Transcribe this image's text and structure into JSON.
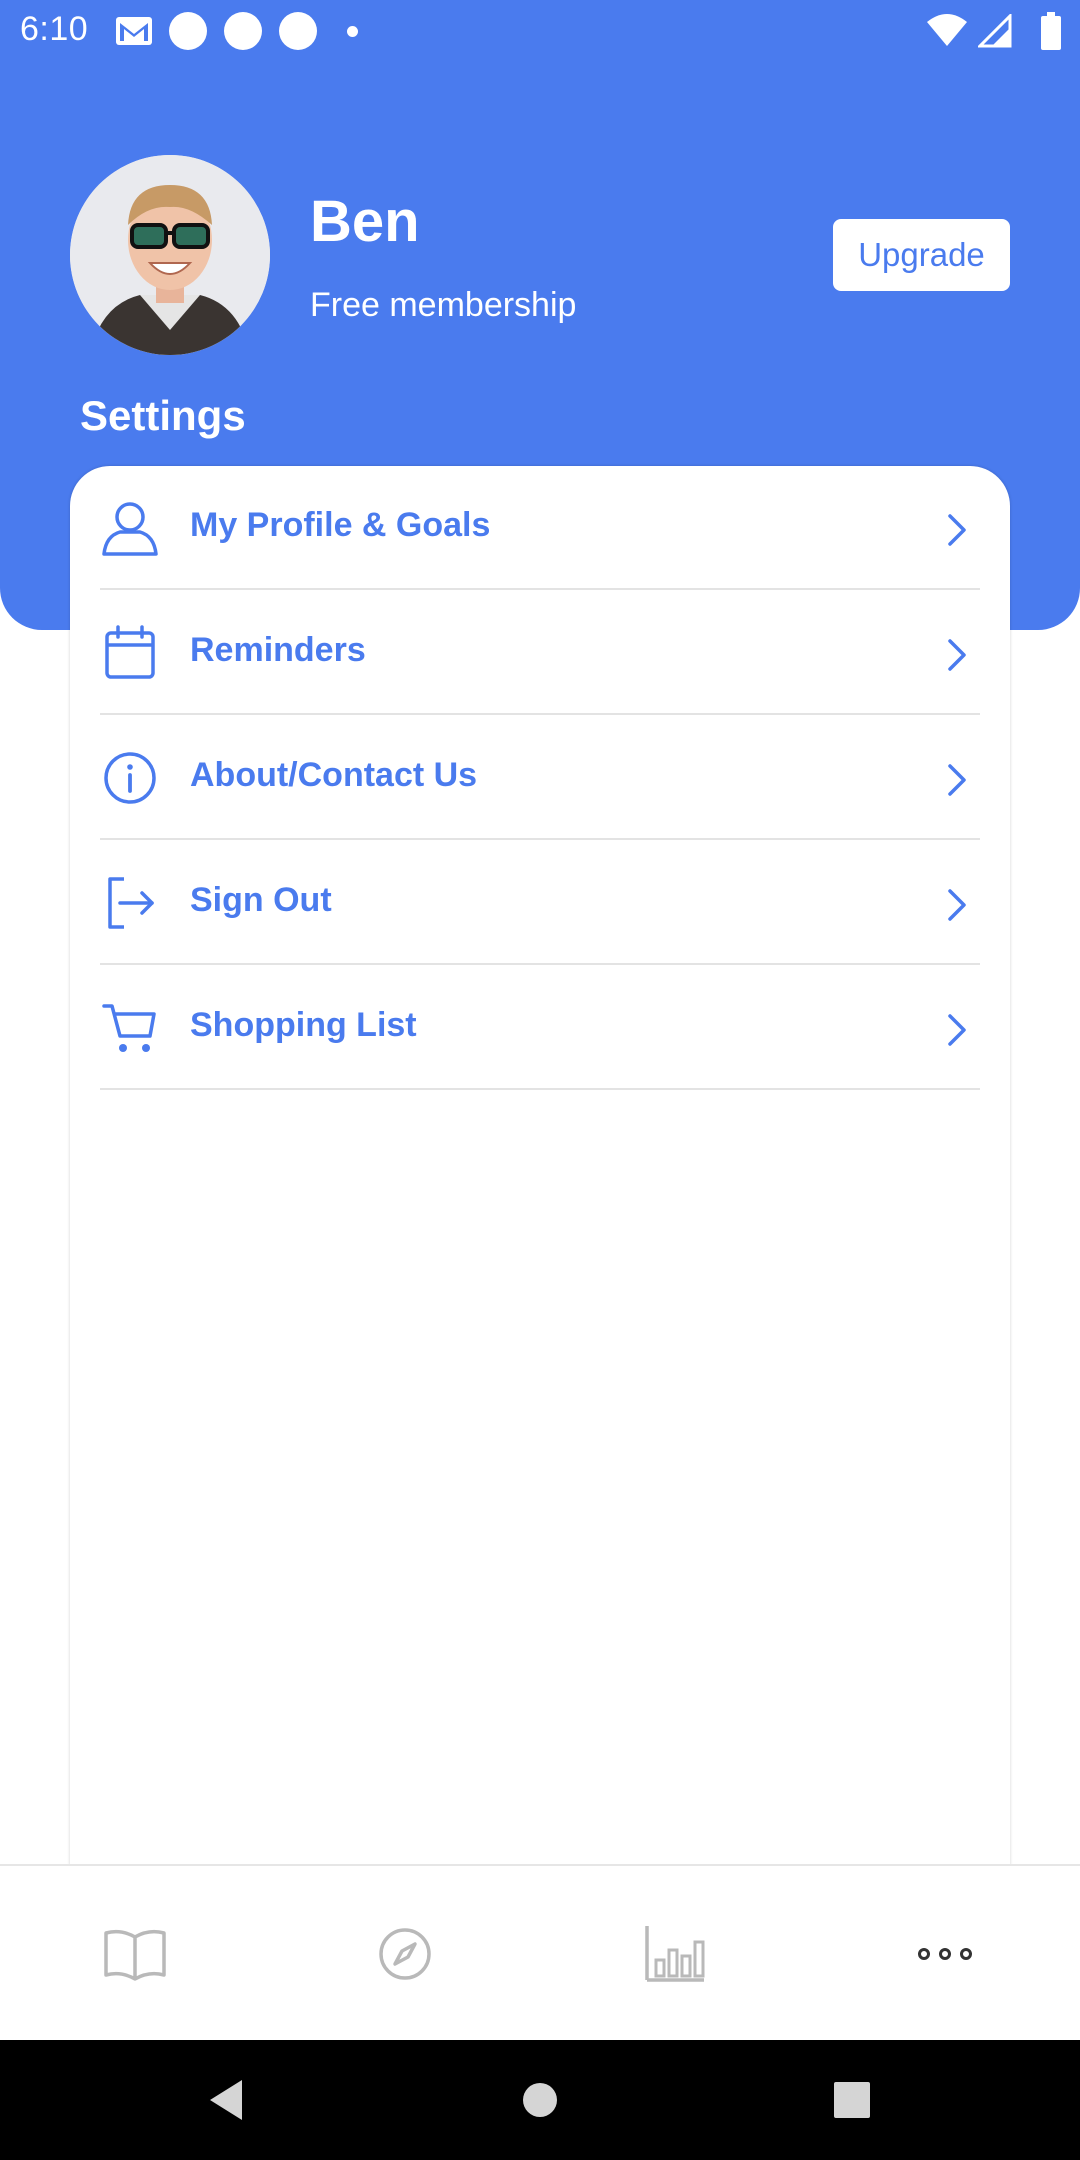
{
  "status_bar": {
    "time": "6:10"
  },
  "profile": {
    "name": "Ben",
    "membership": "Free membership",
    "upgrade_label": "Upgrade"
  },
  "settings": {
    "title": "Settings",
    "items": [
      {
        "label": "My Profile & Goals",
        "icon": "person-icon"
      },
      {
        "label": "Reminders",
        "icon": "calendar-icon"
      },
      {
        "label": "About/Contact Us",
        "icon": "info-icon"
      },
      {
        "label": "Sign Out",
        "icon": "sign-out-icon"
      },
      {
        "label": "Shopping List",
        "icon": "cart-icon"
      }
    ]
  },
  "tabs": [
    {
      "icon": "book-icon",
      "active": false
    },
    {
      "icon": "compass-icon",
      "active": false
    },
    {
      "icon": "bar-chart-icon",
      "active": false
    },
    {
      "icon": "more-icon",
      "active": true
    }
  ],
  "colors": {
    "accent": "#4A7BEE",
    "header_bg": "#4A7BEE",
    "tab_inactive": "#b9b9b9",
    "tab_active": "#333333"
  }
}
